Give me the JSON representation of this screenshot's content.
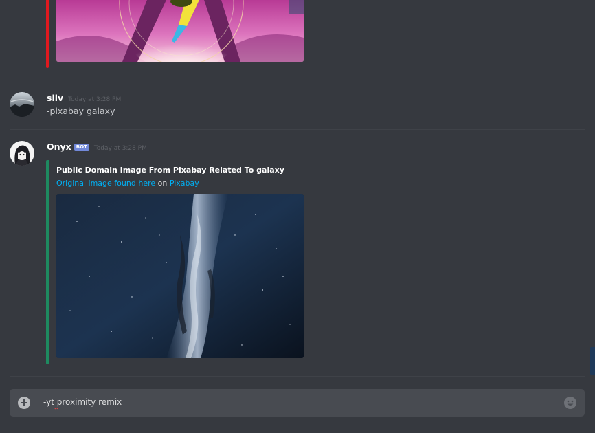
{
  "messages": [
    {
      "author": "silv",
      "timestamp": "Today at 3:28 PM",
      "content": "-pixabay galaxy"
    },
    {
      "author": "Onyx",
      "bot_tag": "BOT",
      "timestamp": "Today at 3:28 PM",
      "embed": {
        "color": "#1e8a60",
        "title": "Public Domain Image From Pixabay Related To galaxy",
        "link_text": "Original image found here",
        "connector": "on",
        "source_link": "Pixabay"
      }
    }
  ],
  "previous_embed": {
    "color": "#e0191f"
  },
  "chat_input": {
    "value": "-yt proximity remix",
    "add_icon": "plus-circle-icon",
    "emoji_icon": "smiley-icon"
  },
  "colors": {
    "background": "#36393f",
    "link": "#00b0f4",
    "bot_tag": "#7289da",
    "input_background": "#484b51"
  }
}
